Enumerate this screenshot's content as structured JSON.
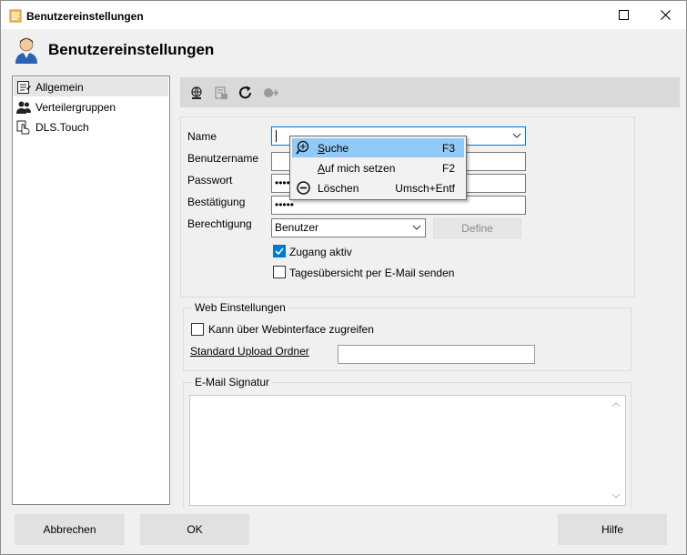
{
  "window": {
    "title": "Benutzereinstellungen",
    "header_title": "Benutzereinstellungen"
  },
  "sidebar": {
    "items": [
      {
        "label": "Allgemein",
        "icon": "form-icon",
        "selected": true
      },
      {
        "label": "Verteilergruppen",
        "icon": "users-icon",
        "selected": false
      },
      {
        "label": "DLS.Touch",
        "icon": "touch-hand-icon",
        "selected": false
      }
    ]
  },
  "toolbar": {
    "icons": [
      "globe-settings-icon",
      "database-icon",
      "refresh-icon",
      "exit-icon"
    ]
  },
  "form": {
    "name_label": "Name",
    "name_value": "",
    "username_label": "Benutzername",
    "username_value": "",
    "password_label": "Passwort",
    "password_value": "••••",
    "confirm_label": "Bestätigung",
    "confirm_value": "•••••",
    "permission_label": "Berechtigung",
    "permission_value": "Benutzer",
    "define_label": "Define",
    "access_active_label": "Zugang aktiv",
    "access_active_checked": true,
    "daily_summary_label": "Tagesübersicht per E-Mail senden",
    "daily_summary_checked": false
  },
  "web_settings": {
    "title": "Web Einstellungen",
    "webinterface_label": "Kann über Webinterface zugreifen",
    "webinterface_checked": false,
    "upload_folder_label": "Standard Upload Ordner",
    "upload_folder_value": ""
  },
  "signature": {
    "title": "E-Mail Signatur",
    "value": ""
  },
  "context_menu": {
    "items": [
      {
        "label": "Suche",
        "shortcut": "F3",
        "icon": "search-icon"
      },
      {
        "label": "Auf mich setzen",
        "shortcut": "F2",
        "icon": ""
      },
      {
        "label": "Löschen",
        "shortcut": "Umsch+Entf",
        "icon": "minus-circle-icon"
      }
    ]
  },
  "footer": {
    "cancel_label": "Abbrechen",
    "ok_label": "OK",
    "help_label": "Hilfe"
  },
  "colors": {
    "accent": "#0078d7",
    "menu_highlight": "#91c9f7"
  }
}
